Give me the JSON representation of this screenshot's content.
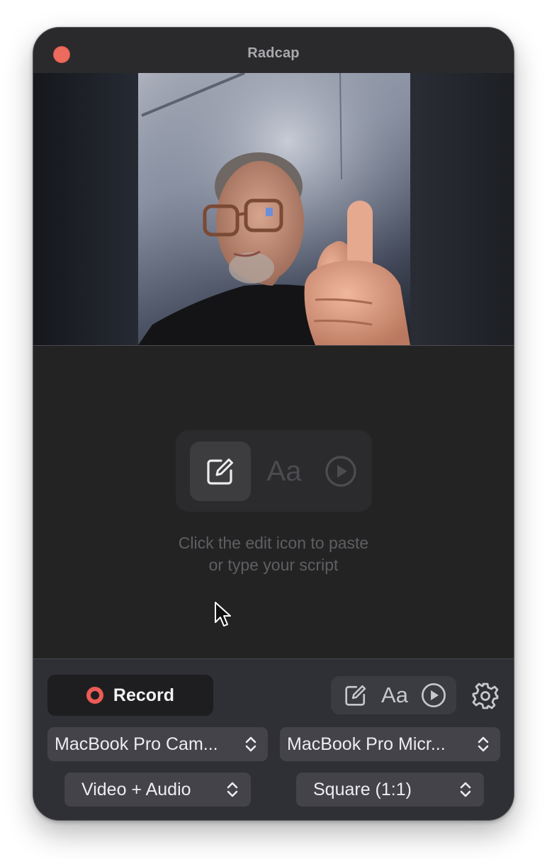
{
  "window": {
    "title": "Radcap"
  },
  "script_panel": {
    "hint_line1": "Click the edit icon to paste",
    "hint_line2": "or type your script",
    "modes": [
      {
        "icon": "edit-icon",
        "active": true
      },
      {
        "label": "Aa",
        "icon": "font-icon",
        "active": false
      },
      {
        "icon": "play-icon",
        "active": false
      }
    ]
  },
  "controls": {
    "record_label": "Record",
    "mini_modes": [
      {
        "icon": "edit-icon"
      },
      {
        "label": "Aa",
        "icon": "font-icon"
      },
      {
        "icon": "play-icon"
      }
    ],
    "settings_icon": "gear-icon",
    "camera_select": "MacBook Pro Cam...",
    "microphone_select": "MacBook Pro Micr...",
    "mode_select": "Video + Audio",
    "aspect_select": "Square (1:1)"
  },
  "colors": {
    "record_red": "#ec5b56",
    "close_red": "#ed6a5e",
    "window_bg": "#262628",
    "controls_bg": "#2f2f36"
  }
}
